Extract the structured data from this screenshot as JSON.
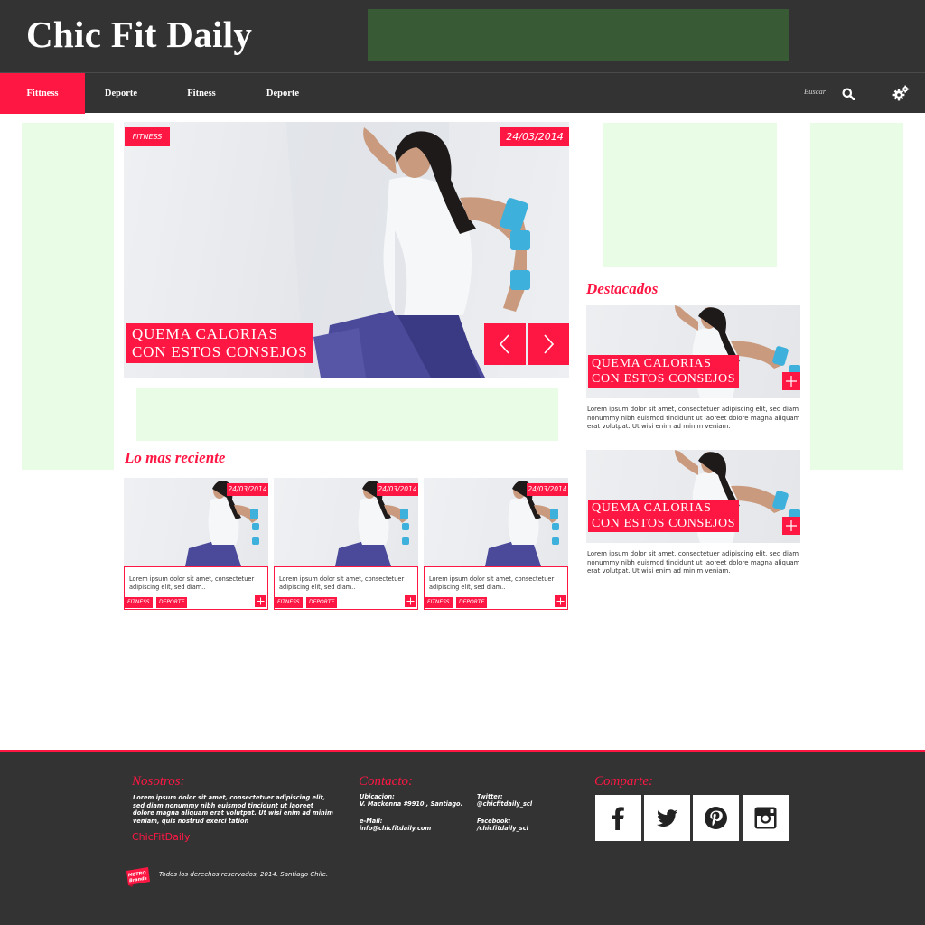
{
  "header": {
    "logo": "Chic Fit Daily",
    "nav": [
      "Fittness",
      "Deporte",
      "Fitness",
      "Deporte"
    ],
    "search_label": "Buscar"
  },
  "hero": {
    "category": "FITNESS",
    "date": "24/03/2014",
    "title_line1": "QUEMA CALORIAS",
    "title_line2": "CON ESTOS CONSEJOS"
  },
  "recent": {
    "heading": "Lo mas reciente",
    "cards": [
      {
        "date": "24/03/2014",
        "text": "Lorem ipsum dolor sit amet, consectetuer adipiscing elit, sed diam..",
        "tags": [
          "FITNESS",
          "DEPORTE"
        ]
      },
      {
        "date": "24/03/2014",
        "text": "Lorem ipsum dolor sit amet, consectetuer adipiscing elit, sed diam..",
        "tags": [
          "FITNESS",
          "DEPORTE"
        ]
      },
      {
        "date": "24/03/2014",
        "text": "Lorem ipsum dolor sit amet, consectetuer adipiscing elit, sed diam..",
        "tags": [
          "FITNESS",
          "DEPORTE"
        ]
      }
    ]
  },
  "featured": {
    "heading": "Destacados",
    "items": [
      {
        "title_line1": "QUEMA CALORIAS",
        "title_line2": "CON ESTOS CONSEJOS",
        "text": "Lorem ipsum dolor sit amet, consectetuer adipiscing elit, sed diam nonummy nibh euismod tincidunt ut laoreet dolore magna aliquam erat volutpat. Ut wisi enim ad minim veniam."
      },
      {
        "title_line1": "QUEMA CALORIAS",
        "title_line2": "CON ESTOS CONSEJOS",
        "text": "Lorem ipsum dolor sit amet, consectetuer adipiscing elit, sed diam nonummy nibh euismod tincidunt ut laoreet dolore magna aliquam erat volutpat. Ut wisi enim ad minim veniam."
      }
    ]
  },
  "footer": {
    "about_title": "Nosotros:",
    "about_text": "Lorem ipsum dolor sit amet, consectetuer adipiscing elit, sed diam nonummy nibh euismod tincidunt ut laoreet dolore magna aliquam erat volutpat. Ut wisi enim ad minim veniam, quis nostrud exerci tation",
    "brand": "ChicFitDaily",
    "contact_title": "Contacto:",
    "location_label": "Ubicacion:",
    "location_value": "V. Mackenna #9910 , Santiago.",
    "email_label": "e-Mail:",
    "email_value": "info@chicfitdaily.com",
    "twitter_label": "Twitter:",
    "twitter_value": "@chicfitdaily_scl",
    "facebook_label": "Facebook:",
    "facebook_value": "/chicfitdaily_scl",
    "share_title": "Comparte:",
    "social_icons": [
      "facebook-icon",
      "twitter-icon",
      "pinterest-icon",
      "instagram-icon"
    ],
    "logo_text": "Metro Brands",
    "copyright": "Todos los derechos reservados, 2014. Santiago Chile."
  },
  "colors": {
    "accent": "#ff1744",
    "dark": "#333333",
    "ad": "#e9fde6",
    "banner": "#385a35"
  }
}
